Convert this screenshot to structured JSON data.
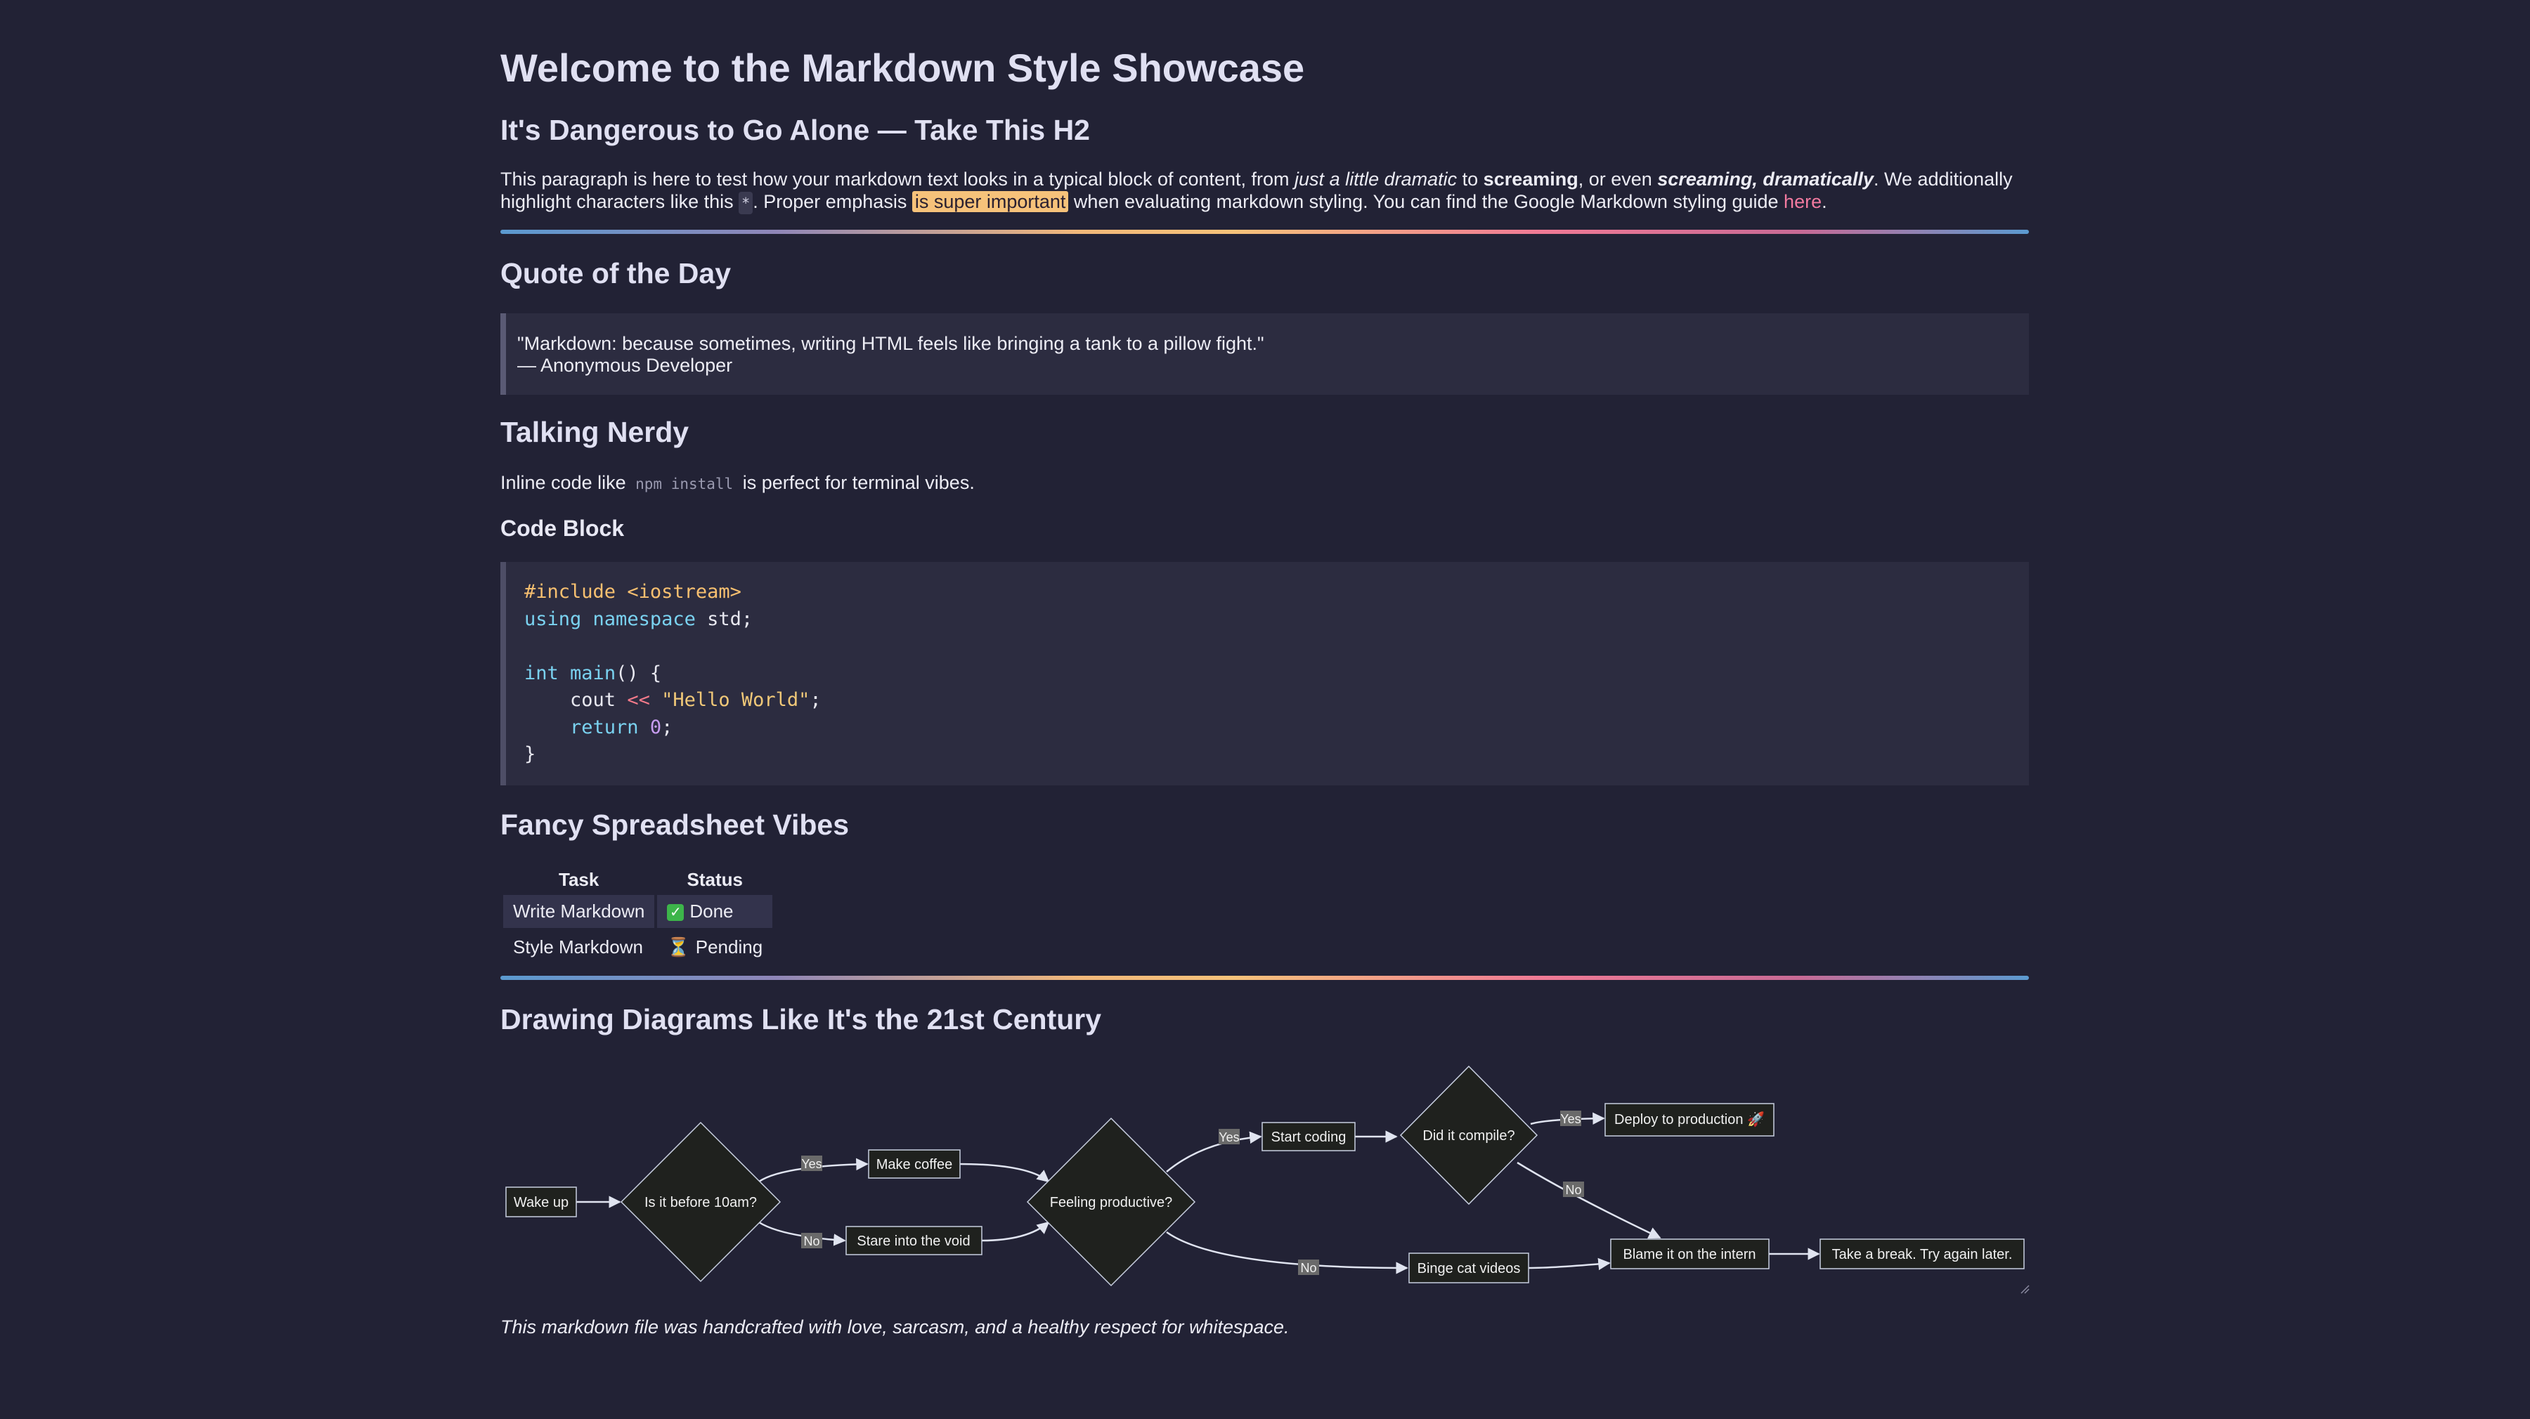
{
  "title": "Welcome to the Markdown Style Showcase",
  "intro": {
    "heading": "It's Dangerous to Go Alone — Take This H2",
    "p1": "This paragraph is here to test how your markdown text looks in a typical block of content, from ",
    "em1": "just a little dramatic",
    "p2": " to ",
    "strong1": "screaming",
    "p3": ", or even ",
    "strongem": "screaming, dramatically",
    "p4": ". We additionally highlight characters like this ",
    "kbd": "*",
    "p5": ". Proper emphasis ",
    "highlight": "is super important",
    "p6": " when evaluating markdown styling. You can find the Google Markdown styling guide ",
    "link": "here",
    "p7": "."
  },
  "quote": {
    "heading": "Quote of the Day",
    "line1": "\"Markdown: because sometimes, writing HTML feels like bringing a tank to a pillow fight.\"",
    "line2": "— Anonymous Developer"
  },
  "nerdy": {
    "heading": "Talking Nerdy",
    "before": "Inline code like ",
    "code": "npm install",
    "after": " is perfect for terminal vibes.",
    "code_heading": "Code Block"
  },
  "code_lines": [
    [
      "#include ",
      "<iostream>"
    ],
    [
      "using",
      " ",
      "namespace",
      " std;"
    ],
    [
      "int",
      " ",
      "main",
      "() {"
    ],
    [
      "    cout ",
      "<<",
      " ",
      "\"Hello World\"",
      ";"
    ],
    [
      "    ",
      "return",
      " ",
      "0",
      ";"
    ],
    [
      "}"
    ]
  ],
  "table": {
    "heading": "Fancy Spreadsheet Vibes",
    "headers": [
      "Task",
      "Status"
    ],
    "rows": [
      {
        "task": "Write Markdown",
        "status": "Done",
        "icon": "check-icon"
      },
      {
        "task": "Style Markdown",
        "status": "Pending",
        "icon": "hourglass-icon"
      }
    ]
  },
  "diagram": {
    "heading": "Drawing Diagrams Like It's the 21st Century",
    "nodes": {
      "wake": "Wake up",
      "before10": "Is it before 10am?",
      "coffee": "Make coffee",
      "stare": "Stare into the void",
      "productive": "Feeling productive?",
      "coding": "Start coding",
      "cat": "Binge cat videos",
      "compile": "Did it compile?",
      "deploy": "Deploy to production 🚀",
      "blame": "Blame it on the intern",
      "break": "Take a break. Try again later."
    },
    "edge_labels": {
      "yes1": "Yes",
      "no1": "No",
      "yes2": "Yes",
      "no2": "No",
      "yes3": "Yes",
      "no3": "No"
    }
  },
  "footer": "This markdown file was handcrafted with love, sarcasm, and a healthy respect for whitespace.",
  "colors": {
    "background": "#222235",
    "highlight": "#f6c27a",
    "link": "#f37aa0",
    "diagram_node_fill": "#1f211e",
    "diagram_stroke": "#c8cfe0"
  }
}
